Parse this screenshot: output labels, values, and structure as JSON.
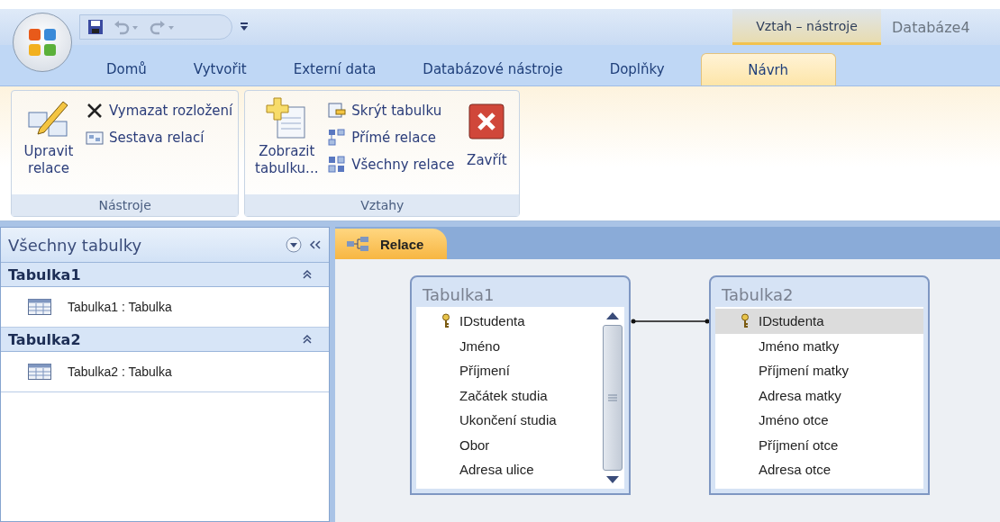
{
  "window": {
    "context_title": "Vztah – nástroje",
    "title": "Databáze4"
  },
  "menu_tabs": [
    {
      "label": "Domů",
      "selected": false
    },
    {
      "label": "Vytvořit",
      "selected": false
    },
    {
      "label": "Externí data",
      "selected": false
    },
    {
      "label": "Databázové nástroje",
      "selected": false
    },
    {
      "label": "Doplňky",
      "selected": false
    },
    {
      "label": "Návrh",
      "selected": true
    }
  ],
  "ribbon_groups": [
    {
      "title": "Nástroje",
      "large": [
        {
          "label": "Upravit relace"
        }
      ],
      "small": [
        {
          "label": "Vymazat rozložení"
        },
        {
          "label": "Sestava relací"
        }
      ]
    },
    {
      "title": "Vztahy",
      "large": [
        {
          "label": "Zobrazit tabulku..."
        }
      ],
      "small": [
        {
          "label": "Skrýt tabulku"
        },
        {
          "label": "Přímé relace"
        },
        {
          "label": "Všechny relace"
        }
      ],
      "after": [
        {
          "label": "Zavřít"
        }
      ]
    }
  ],
  "nav_pane": {
    "title": "Všechny tabulky",
    "groups": [
      {
        "name": "Tabulka1",
        "expanded": true,
        "items": [
          "Tabulka1 : Tabulka"
        ]
      },
      {
        "name": "Tabulka2",
        "expanded": true,
        "items": [
          "Tabulka2 : Tabulka"
        ]
      }
    ]
  },
  "document_tab": {
    "label": "Relace"
  },
  "tables": [
    {
      "title": "Tabulka1",
      "scrollbar": true,
      "fields": [
        {
          "name": "IDstudenta",
          "key": true,
          "selected": false
        },
        {
          "name": "Jméno",
          "key": false,
          "selected": false
        },
        {
          "name": "Příjmení",
          "key": false,
          "selected": false
        },
        {
          "name": "Začátek studia",
          "key": false,
          "selected": false
        },
        {
          "name": "Ukončení studia",
          "key": false,
          "selected": false
        },
        {
          "name": "Obor",
          "key": false,
          "selected": false
        },
        {
          "name": "Adresa ulice",
          "key": false,
          "selected": false
        }
      ]
    },
    {
      "title": "Tabulka2",
      "scrollbar": false,
      "fields": [
        {
          "name": "IDstudenta",
          "key": true,
          "selected": true
        },
        {
          "name": "Jméno matky",
          "key": false,
          "selected": false
        },
        {
          "name": "Příjmení matky",
          "key": false,
          "selected": false
        },
        {
          "name": "Adresa matky",
          "key": false,
          "selected": false
        },
        {
          "name": "Jméno otce",
          "key": false,
          "selected": false
        },
        {
          "name": "Příjmení otce",
          "key": false,
          "selected": false
        },
        {
          "name": "Adresa otce",
          "key": false,
          "selected": false
        }
      ]
    }
  ]
}
